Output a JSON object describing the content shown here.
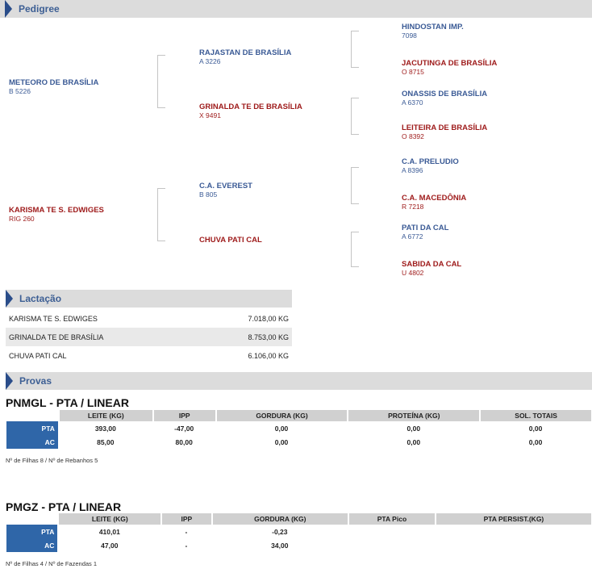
{
  "sections": {
    "pedigree": "Pedigree",
    "lactacao": "Lactação",
    "provas": "Provas"
  },
  "pedigree": {
    "sire": {
      "name": "METEORO DE BRASÍLIA",
      "reg": "B 5226"
    },
    "dam": {
      "name": "KARISMA TE S. EDWIGES",
      "reg": "RIG 260"
    },
    "ss": {
      "name": "RAJASTAN DE BRASÍLIA",
      "reg": "A 3226"
    },
    "sd": {
      "name": "GRINALDA TE DE BRASÍLIA",
      "reg": "X 9491"
    },
    "ds": {
      "name": "C.A. EVEREST",
      "reg": "B 805"
    },
    "dd": {
      "name": "CHUVA PATI CAL",
      "reg": ""
    },
    "sss": {
      "name": "HINDOSTAN IMP.",
      "reg": "7098"
    },
    "ssd": {
      "name": "JACUTINGA DE BRASÍLIA",
      "reg": "O 8715"
    },
    "sds": {
      "name": "ONASSIS DE BRASÍLIA",
      "reg": "A 6370"
    },
    "sdd": {
      "name": "LEITEIRA DE BRASÍLIA",
      "reg": "O 8392"
    },
    "dss": {
      "name": "C.A. PRELUDIO",
      "reg": "A 8396"
    },
    "dsd": {
      "name": "C.A. MACEDÔNIA",
      "reg": "R 7218"
    },
    "dds": {
      "name": "PATI DA CAL",
      "reg": "A 6772"
    },
    "ddd": {
      "name": "SABIDA DA CAL",
      "reg": "U 4802"
    }
  },
  "lactacao": [
    {
      "name": "KARISMA TE S. EDWIGES",
      "value": "7.018,00 KG"
    },
    {
      "name": "GRINALDA TE DE BRASÍLIA",
      "value": "8.753,00 KG"
    },
    {
      "name": "CHUVA PATI CAL",
      "value": "6.106,00 KG"
    }
  ],
  "provas": [
    {
      "title": "PNMGL - PTA / LINEAR",
      "headers": [
        "LEITE (KG)",
        "IPP",
        "GORDURA (KG)",
        "PROTEÍNA (KG)",
        "SOL. TOTAIS"
      ],
      "rows": [
        {
          "label": "PTA",
          "values": [
            "393,00",
            "-47,00",
            "0,00",
            "0,00",
            "0,00"
          ]
        },
        {
          "label": "AC",
          "values": [
            "85,00",
            "80,00",
            "0,00",
            "0,00",
            "0,00"
          ]
        }
      ],
      "footer": "Nº de Filhas 8 / Nº de Rebanhos 5"
    },
    {
      "title": "PMGZ - PTA / LINEAR",
      "headers": [
        "LEITE (KG)",
        "IPP",
        "GORDURA (KG)",
        "PTA Pico",
        "PTA PERSIST.(KG)"
      ],
      "rows": [
        {
          "label": "PTA",
          "values": [
            "410,01",
            "-",
            "-0,23",
            "",
            ""
          ]
        },
        {
          "label": "AC",
          "values": [
            "47,00",
            "-",
            "34,00",
            "",
            ""
          ]
        }
      ],
      "footer": "Nº de Filhas 4 / Nº de Fazendas 1"
    }
  ],
  "colors": {
    "section_bg": "#dcdcdc",
    "section_title": "#3d5f94",
    "male": "#3a5a95",
    "female": "#9e1a1a",
    "row_label_bg": "#2f66a8"
  }
}
